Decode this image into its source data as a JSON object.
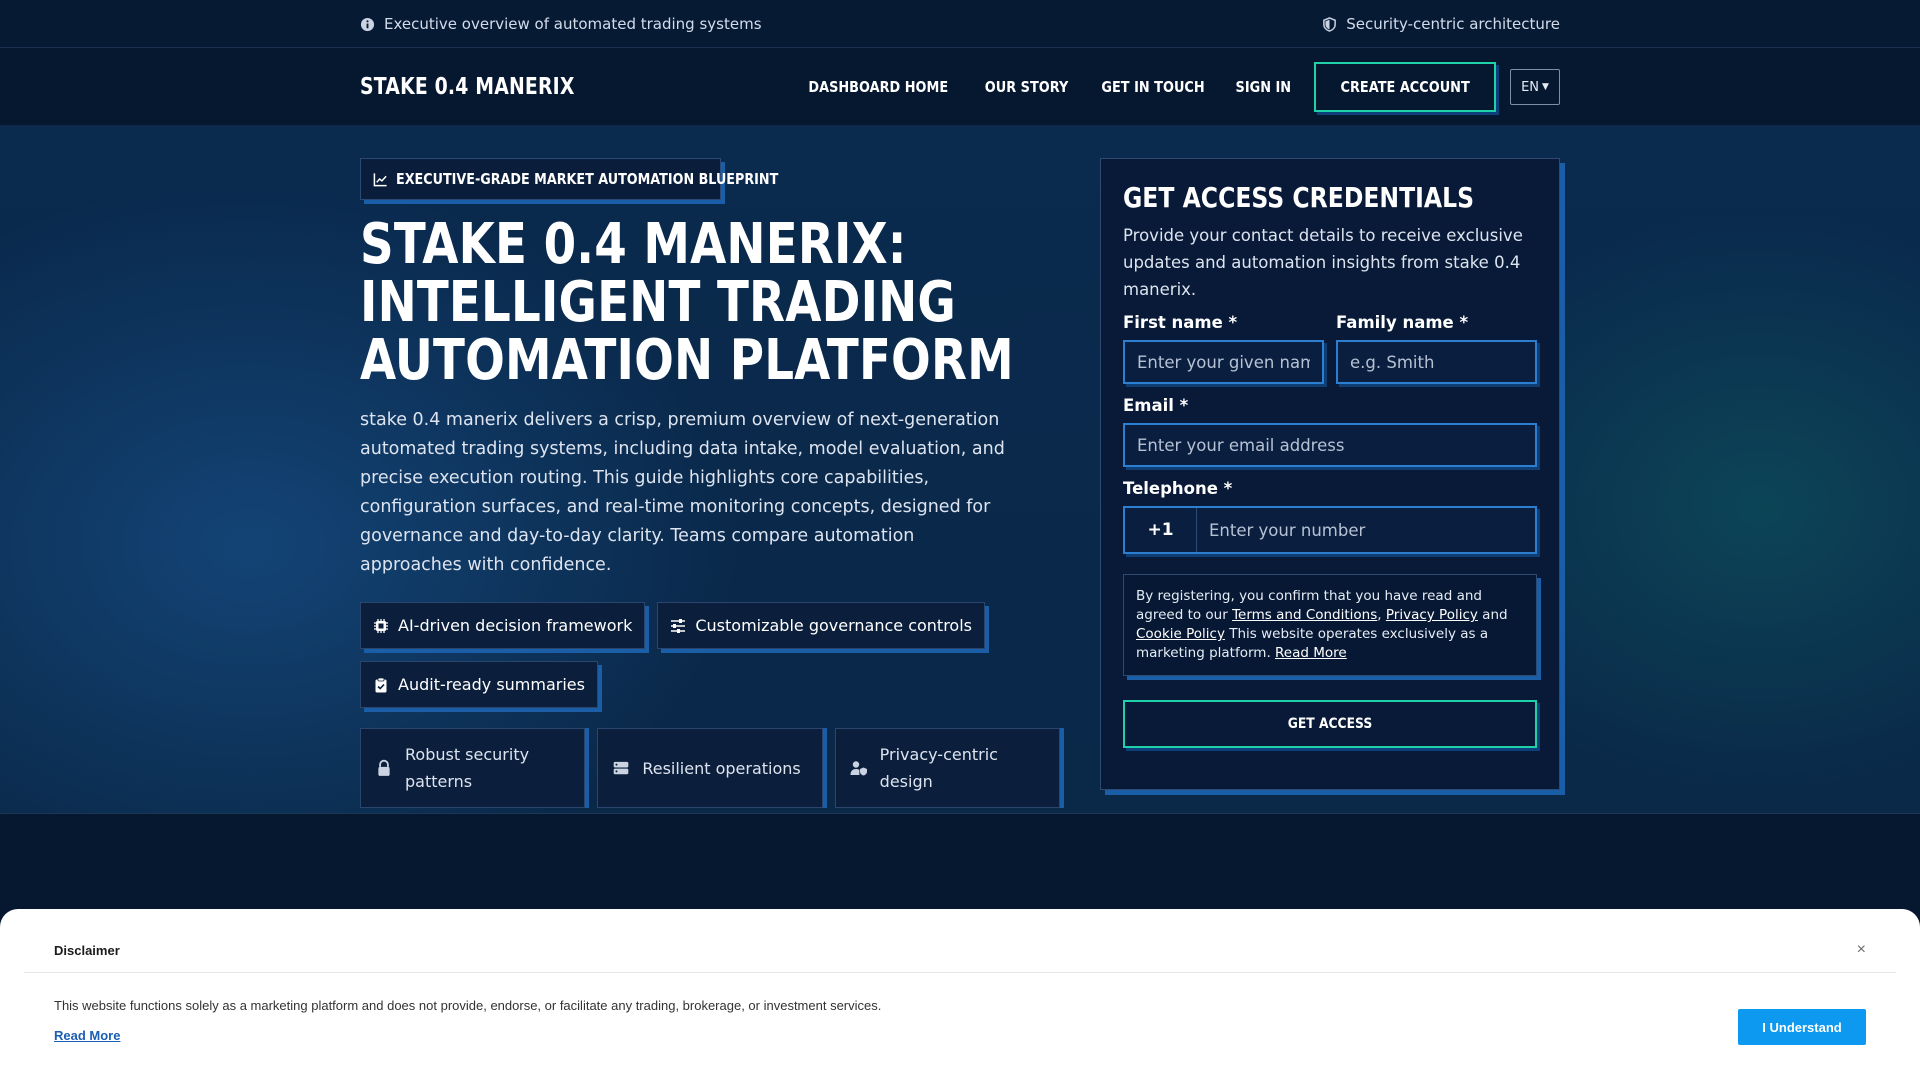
{
  "topbar": {
    "left_text": "Executive overview of automated trading systems",
    "right_text": "Security-centric architecture"
  },
  "nav": {
    "brand": "STAKE 0.4 MANERIX",
    "links": [
      "DASHBOARD HOME",
      "OUR STORY",
      "GET IN TOUCH",
      "SIGN IN"
    ],
    "create_account": "CREATE ACCOUNT",
    "language": "EN"
  },
  "hero": {
    "tagline": "EXECUTIVE-GRADE MARKET AUTOMATION BLUEPRINT",
    "title": "STAKE 0.4 MANERIX: INTELLIGENT TRADING AUTOMATION PLATFORM",
    "description": "stake 0.4 manerix delivers a crisp, premium overview of next-generation automated trading systems, including data intake, model evaluation, and precise execution routing. This guide highlights core capabilities, configuration surfaces, and real-time monitoring concepts, designed for governance and day-to-day clarity. Teams compare automation approaches with confidence.",
    "features": [
      {
        "icon": "chip-icon",
        "label": "AI-driven decision framework"
      },
      {
        "icon": "sliders-icon",
        "label": "Customizable governance controls"
      },
      {
        "icon": "clipboard-check-icon",
        "label": "Audit-ready summaries"
      }
    ],
    "trust": [
      {
        "icon": "lock-icon",
        "label": "Robust security patterns"
      },
      {
        "icon": "server-icon",
        "label": "Resilient operations"
      },
      {
        "icon": "user-shield-icon",
        "label": "Privacy-centric design"
      }
    ]
  },
  "form": {
    "title": "GET ACCESS CREDENTIALS",
    "lead": "Provide your contact details to receive exclusive updates and automation insights from stake 0.4 manerix.",
    "first_name_label": "First name *",
    "first_name_placeholder": "Enter your given name",
    "family_name_label": "Family name *",
    "family_name_placeholder": "e.g. Smith",
    "email_label": "Email *",
    "email_placeholder": "Enter your email address",
    "phone_label": "Telephone *",
    "phone_code": "+1",
    "phone_placeholder": "Enter your number",
    "consent_prefix": "By registering, you confirm that you have read and agreed to our ",
    "terms": "Terms and Conditions",
    "comma": ", ",
    "privacy": "Privacy Policy",
    "and": " and ",
    "cookie": "Cookie Policy",
    "consent_suffix": " This website operates exclusively as a marketing platform. ",
    "read_more": "Read More",
    "submit": "GET ACCESS"
  },
  "disclaimer": {
    "title": "Disclaimer",
    "close": "×",
    "body": "This website functions solely as a marketing platform and does not provide, endorse, or facilitate any trading, brokerage, or investment services.",
    "read_more": "Read More",
    "accept": "I Understand"
  },
  "colors": {
    "background": "#071a33",
    "accent_teal": "#1fd1a8",
    "accent_blue": "#1b5ea8",
    "button_blue": "#0d99f0"
  }
}
